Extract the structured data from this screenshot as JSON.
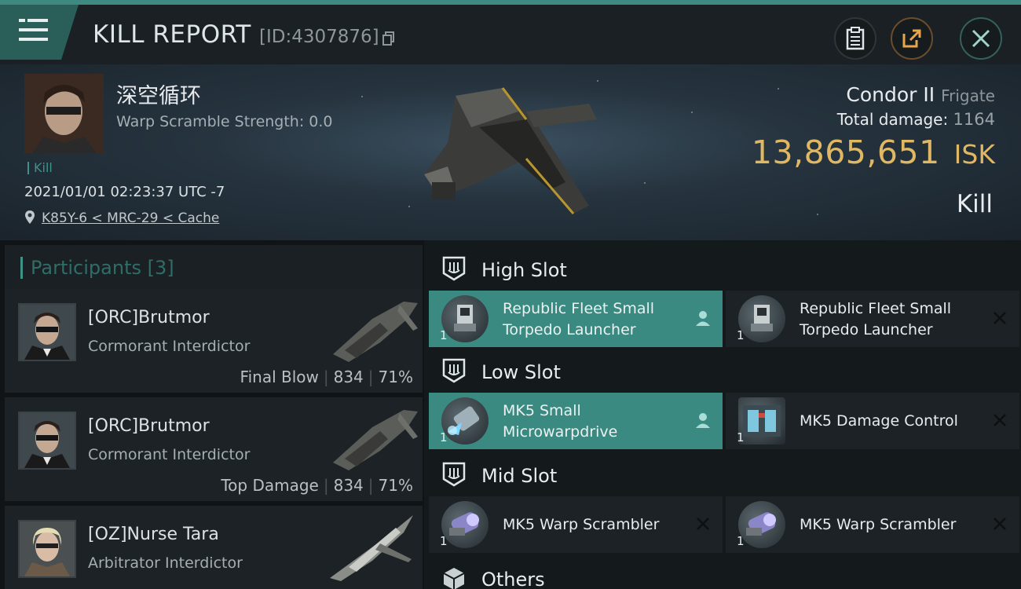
{
  "header": {
    "title": "KILL REPORT",
    "report_id": "[ID:4307876]"
  },
  "victim": {
    "pilot_name": "深空循环",
    "warp_scramble": "Warp Scramble Strength: 0.0",
    "tag": "Kill",
    "datetime": "2021/01/01 02:23:37 UTC -7",
    "location": "K85Y-6 < MRC-29 < Cache",
    "ship_name": "Condor II",
    "ship_class": "Frigate",
    "total_damage_label": "Total damage:",
    "total_damage_value": "1164",
    "isk_value": "13,865,651",
    "isk_unit": "ISK",
    "result": "Kill"
  },
  "participants": {
    "label": "Participants [3]",
    "rows": [
      {
        "name": "[ORC]Brutmor",
        "ship": "Cormorant Interdictor",
        "role": "Final Blow",
        "damage": "834",
        "percent": "71%"
      },
      {
        "name": "[ORC]Brutmor",
        "ship": "Cormorant Interdictor",
        "role": "Top Damage",
        "damage": "834",
        "percent": "71%"
      },
      {
        "name": "[OZ]Nurse Tara",
        "ship": "Arbitrator Interdictor",
        "role": "",
        "damage": "",
        "percent": ""
      }
    ]
  },
  "slots": {
    "high": {
      "label": "High Slot",
      "modules": [
        {
          "line1": "Republic Fleet Small",
          "line2": "Torpedo Launcher",
          "qty": "1",
          "status": "person-icon"
        },
        {
          "line1": "Republic Fleet Small",
          "line2": "Torpedo Launcher",
          "qty": "1",
          "status": "x-icon"
        }
      ]
    },
    "low": {
      "label": "Low Slot",
      "modules": [
        {
          "line1": "MK5 Small",
          "line2": "Microwarpdrive",
          "qty": "1",
          "status": "person-icon"
        },
        {
          "line1": "MK5 Damage Control",
          "line2": "",
          "qty": "1",
          "status": "x-icon"
        }
      ]
    },
    "mid": {
      "label": "Mid Slot",
      "modules": [
        {
          "line1": "MK5 Warp Scrambler",
          "line2": "",
          "qty": "1",
          "status": "x-icon"
        },
        {
          "line1": "MK5 Warp Scrambler",
          "line2": "",
          "qty": "1",
          "status": "x-icon"
        }
      ]
    },
    "others": {
      "label": "Others"
    }
  },
  "colors": {
    "accent": "#3e9387",
    "highlight_module": "#3a8a82",
    "isk": "#e0b864"
  }
}
